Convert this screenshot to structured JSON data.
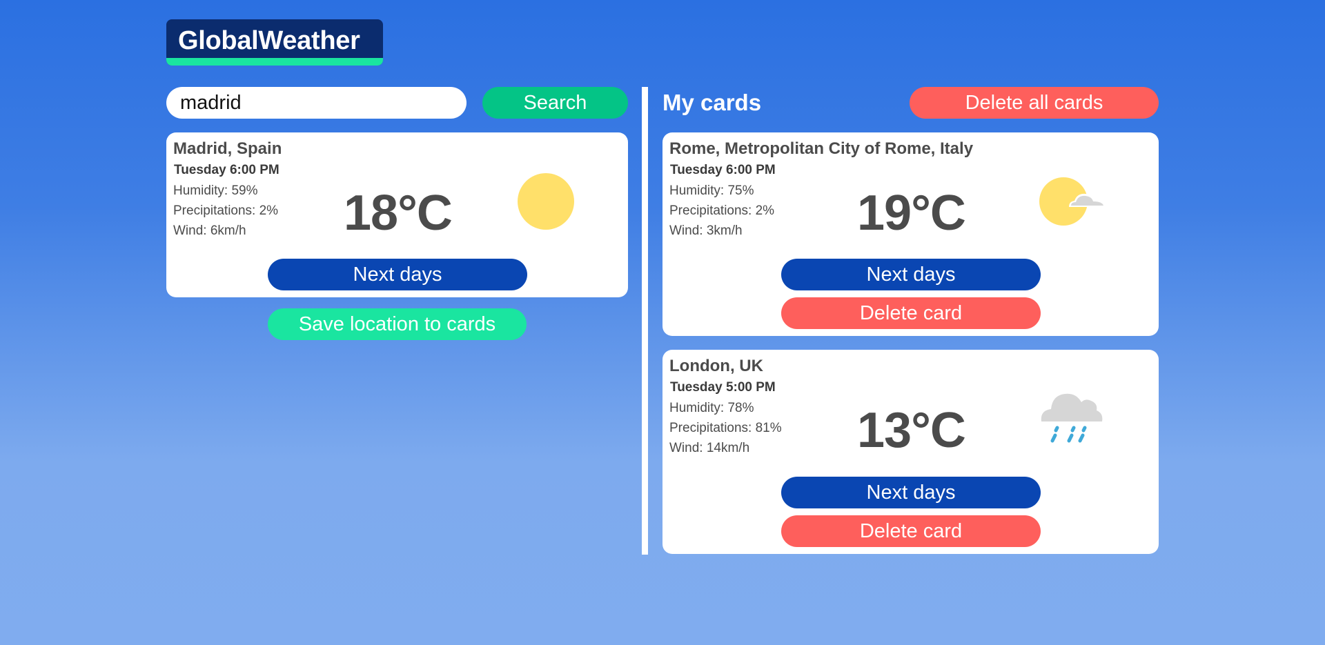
{
  "app": {
    "title": "GlobalWeather",
    "accent": "#1ae5a0",
    "brand": "#0b2c6e"
  },
  "search": {
    "value": "madrid",
    "button_label": "Search"
  },
  "current": {
    "location": "Madrid, Spain",
    "time": "Tuesday 6:00 PM",
    "humidity": "Humidity: 59%",
    "precipitations": "Precipitations: 2%",
    "wind": "Wind: 6km/h",
    "temperature": "18°C",
    "icon": "sun-icon",
    "next_days_label": "Next days",
    "save_label": "Save location to cards"
  },
  "my_cards": {
    "title": "My cards",
    "delete_all_label": "Delete all cards",
    "cards": [
      {
        "location": "Rome, Metropolitan City of Rome, Italy",
        "time": "Tuesday 6:00 PM",
        "humidity": "Humidity: 75%",
        "precipitations": "Precipitations: 2%",
        "wind": "Wind: 3km/h",
        "temperature": "19°C",
        "icon": "sun-cloud-icon",
        "next_days_label": "Next days",
        "delete_label": "Delete card"
      },
      {
        "location": "London, UK",
        "time": "Tuesday 5:00 PM",
        "humidity": "Humidity: 78%",
        "precipitations": "Precipitations: 81%",
        "wind": "Wind: 14km/h",
        "temperature": "13°C",
        "icon": "rain-cloud-icon",
        "next_days_label": "Next days",
        "delete_label": "Delete card"
      }
    ]
  },
  "colors": {
    "search_button": "#04c486",
    "next_days_button": "#0a46b2",
    "delete_button": "#fe5f5c",
    "save_button": "#1ae5a0"
  }
}
